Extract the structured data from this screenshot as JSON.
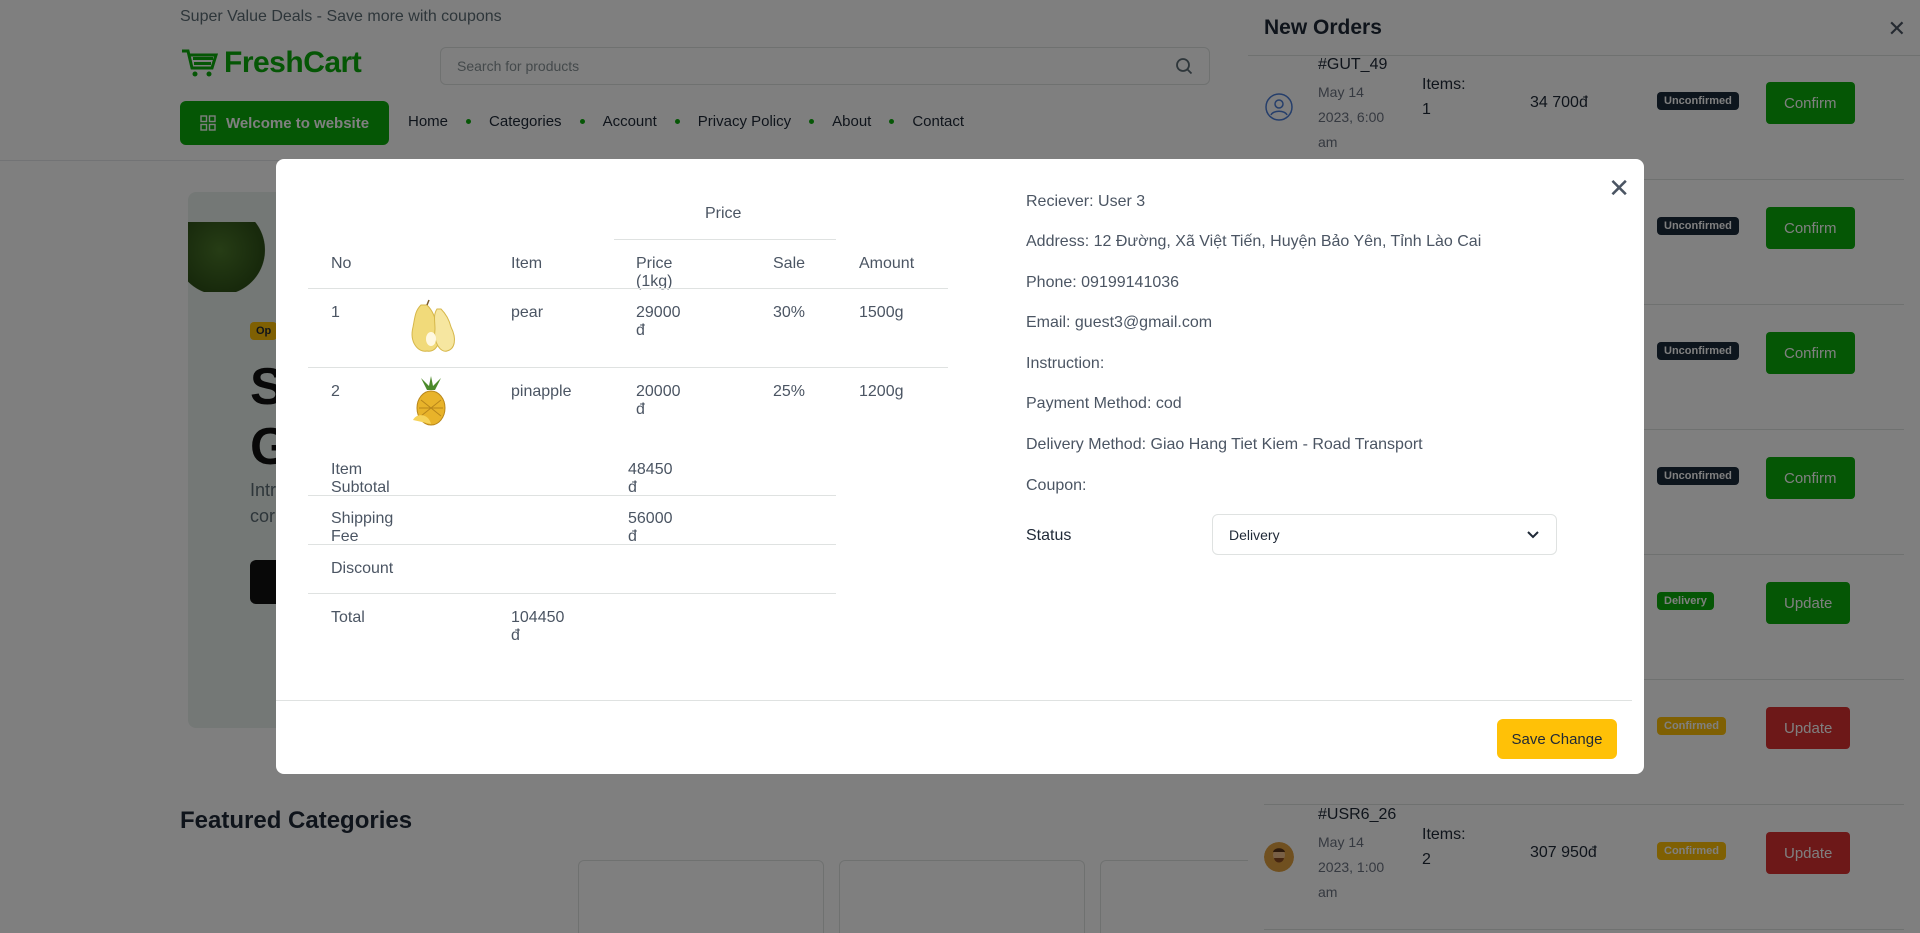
{
  "site": {
    "topbar_text": "Super Value Deals - Save more with coupons",
    "logo_text": "FreshCart",
    "search_placeholder": "Search for products",
    "welcome_button": "Welcome to website",
    "nav": [
      "Home",
      "Categories",
      "Account",
      "Privacy Policy",
      "About",
      "Contact"
    ],
    "featured_heading": "Featured Categories",
    "brand_color": "#0aad0a"
  },
  "drawer": {
    "title": "New Orders",
    "orders": [
      {
        "id": "#GUT_49",
        "date": "May 14 2023, 6:00 am",
        "items_label": "Items:",
        "items": "1",
        "total": "34 700đ",
        "status": "Unconfirmed",
        "action": "Confirm"
      },
      {
        "id": "",
        "date": "",
        "items_label": "",
        "items": "",
        "total": "",
        "status": "Unconfirmed",
        "action": "Confirm"
      },
      {
        "id": "",
        "date": "",
        "items_label": "",
        "items": "",
        "total": "",
        "status": "Unconfirmed",
        "action": "Confirm"
      },
      {
        "id": "",
        "date": "",
        "items_label": "",
        "items": "",
        "total": "",
        "status": "Unconfirmed",
        "action": "Confirm"
      },
      {
        "id": "",
        "date": "",
        "items_label": "",
        "items": "",
        "total": "",
        "status": "Delivery",
        "action": "Update"
      },
      {
        "id": "",
        "date": "",
        "items_label": "",
        "items": "",
        "total": "",
        "status": "Confirmed",
        "action": "Update"
      },
      {
        "id": "#USR6_26",
        "date": "May 14 2023, 1:00 am",
        "items_label": "Items:",
        "items": "2",
        "total": "307 950đ",
        "status": "Confirmed",
        "action": "Update"
      }
    ]
  },
  "modal": {
    "table": {
      "group_header": "Price",
      "headers": {
        "no": "No",
        "item": "Item",
        "price": "Price (1kg)",
        "sale": "Sale",
        "amount": "Amount"
      },
      "rows": [
        {
          "no": "1",
          "image_icon": "pear-icon",
          "item": "pear",
          "price": "29000 đ",
          "sale": "30%",
          "amount": "1500g"
        },
        {
          "no": "2",
          "image_icon": "pineapple-icon",
          "item": "pinapple",
          "price": "20000 đ",
          "sale": "25%",
          "amount": "1200g"
        }
      ],
      "subtotal_label": "Item Subtotal",
      "subtotal_value": "48450 đ",
      "shipping_label": "Shipping Fee",
      "shipping_value": "56000 đ",
      "discount_label": "Discount",
      "discount_value": "",
      "total_label": "Total",
      "total_value": "104450 đ"
    },
    "info": {
      "receiver": "Reciever: User 3",
      "address": "Address: 12 Đường, Xã Việt Tiến, Huyện Bảo Yên, Tỉnh Lào Cai",
      "phone": "Phone: 09199141036",
      "email": "Email: guest3@gmail.com",
      "instruction": "Instruction:",
      "payment": "Payment Method: cod",
      "delivery": "Delivery Method: Giao Hang Tiet Kiem - Road Transport",
      "coupon": "Coupon:"
    },
    "status_label": "Status",
    "status_value": "Delivery",
    "save_button": "Save Change"
  }
}
